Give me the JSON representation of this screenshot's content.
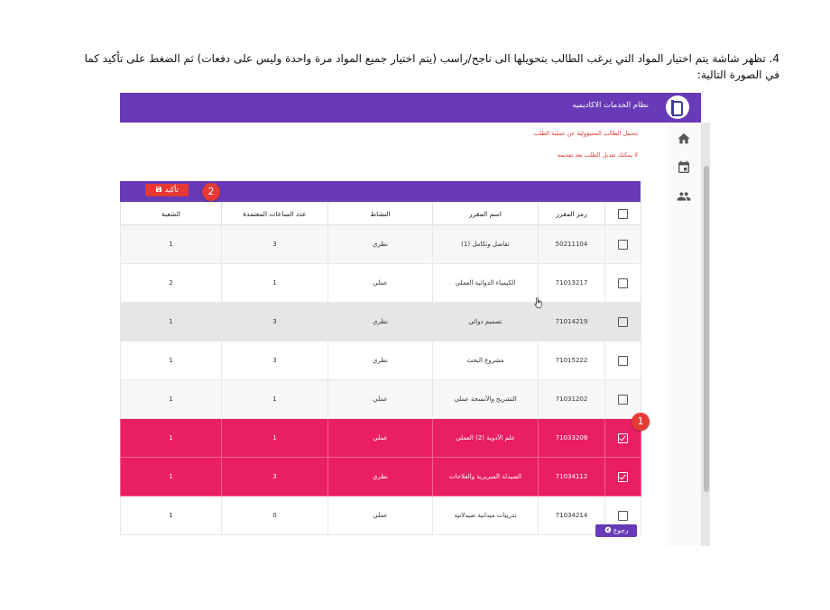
{
  "document": {
    "step_number": "4.",
    "instruction": "تظهر شاشة يتم اختيار المواد التي يرغب الطالب بتحويلها الى ناجح/راسب (يتم اختيار جميع المواد مرة واحدة وليس على دفعات) ثم الضغط على تأكيد كما في الصورة التالية:"
  },
  "app": {
    "title": "نظام الخدمات الاكاديميه",
    "accent": "#673ab7",
    "notices": [
      "يتحمل الطالب المسؤولية عن عملية الطلب",
      "لا يمكنك تعديل الطلب بعد تقديمه"
    ],
    "confirm_label": "تأكيد",
    "back_label": "رجوع",
    "nav_icons": [
      "home-icon",
      "calendar-icon",
      "people-icon"
    ],
    "badges": {
      "one": "1",
      "two": "2"
    }
  },
  "table": {
    "headers": {
      "code": "رمز المقرر",
      "name": "اسم المقرر",
      "activity": "النشاط",
      "hours": "عدد الساعات المعتمدة",
      "section": "الشعبة"
    },
    "rows": [
      {
        "code": "50211104",
        "name": "تفاضل وتكامل (1)",
        "activity": "نظري",
        "hours": "3",
        "section": "1",
        "selected": false,
        "state": "odd"
      },
      {
        "code": "71013217",
        "name": "الكيمياء الدوائية العملي",
        "activity": "عملي",
        "hours": "1",
        "section": "2",
        "selected": false,
        "state": "even"
      },
      {
        "code": "71014219",
        "name": "تصميم دوائي",
        "activity": "نظري",
        "hours": "3",
        "section": "1",
        "selected": false,
        "state": "hover"
      },
      {
        "code": "71015222",
        "name": "مشروع البحث",
        "activity": "نظري",
        "hours": "3",
        "section": "1",
        "selected": false,
        "state": "even"
      },
      {
        "code": "71031202",
        "name": "التشريح والأنسجة عملي",
        "activity": "عملي",
        "hours": "1",
        "section": "1",
        "selected": false,
        "state": "odd"
      },
      {
        "code": "71033208",
        "name": "علم الأدوية (2) العملي",
        "activity": "عملي",
        "hours": "1",
        "section": "1",
        "selected": true,
        "state": "selected"
      },
      {
        "code": "71034112",
        "name": "الصيدلة السريرية والعلاجات",
        "activity": "نظري",
        "hours": "3",
        "section": "1",
        "selected": true,
        "state": "selected"
      },
      {
        "code": "71034214",
        "name": "تدريبات ميدانية صيدلانية",
        "activity": "عملي",
        "hours": "0",
        "section": "1",
        "selected": false,
        "state": "even"
      }
    ]
  }
}
